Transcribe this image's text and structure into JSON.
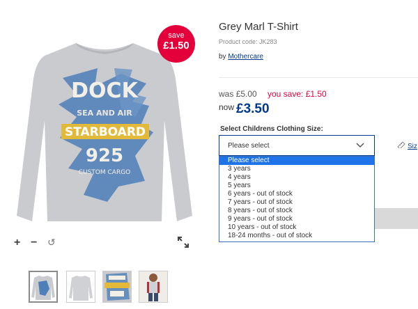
{
  "product": {
    "title": "Grey Marl T-Shirt",
    "code": "Product code: JK283",
    "by_prefix": "by",
    "brand": "Mothercare"
  },
  "badge": {
    "line1": "save",
    "line2": "£1.50"
  },
  "graphic": {
    "line1": "DOCK",
    "line2": "SEA AND AIR",
    "line3": "STARBOARD",
    "line4": "925",
    "line5": "CUSTOM CARGO"
  },
  "pricing": {
    "was_label": "was",
    "was_price": "£5.00",
    "save_text": "you save: £1.50",
    "now_label": "now",
    "now_price": "£3.50"
  },
  "size": {
    "label": "Select Childrens Clothing Size:",
    "selected": "Please select",
    "guide_label": "Siz",
    "options": [
      "Please select",
      "3 years",
      "4 years",
      "5 years",
      "6 years - out of stock",
      "7 years - out of stock",
      "8 years - out of stock",
      "9 years - out of stock",
      "10 years - out of stock",
      "18-24 months - out of stock"
    ]
  },
  "controls": {
    "zoom_in": "+",
    "zoom_out": "−",
    "reset": "↺"
  },
  "colors": {
    "accent_red": "#e4003b",
    "brand_blue": "#003a8c",
    "highlight_blue": "#1e73e8"
  }
}
